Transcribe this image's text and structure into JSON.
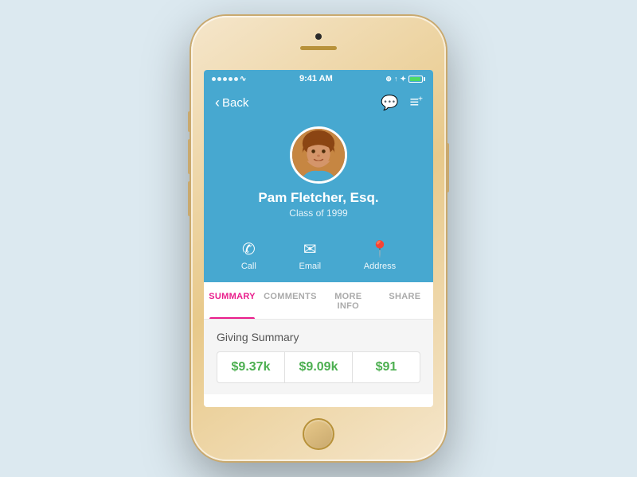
{
  "phone": {
    "status_bar": {
      "time": "9:41 AM",
      "signal_dots": 5,
      "wifi": "WiFi",
      "location_icon": "⊕",
      "arrow_icon": "↑",
      "bluetooth_icon": "❋",
      "battery_level": 80
    },
    "header": {
      "back_label": "Back",
      "comment_icon": "💬",
      "add_list_icon": "≡+"
    },
    "profile": {
      "name": "Pam Fletcher, Esq.",
      "subtitle": "Class of 1999"
    },
    "actions": [
      {
        "id": "call",
        "icon": "📞",
        "label": "Call"
      },
      {
        "id": "email",
        "icon": "✉",
        "label": "Email"
      },
      {
        "id": "address",
        "icon": "📍",
        "label": "Address"
      }
    ],
    "tabs": [
      {
        "id": "summary",
        "label": "SUMMARY",
        "active": true
      },
      {
        "id": "comments",
        "label": "COMMENTS",
        "active": false
      },
      {
        "id": "more_info",
        "label": "MORE INFO",
        "active": false
      },
      {
        "id": "share",
        "label": "SHARE",
        "active": false
      }
    ],
    "content": {
      "section_title": "Giving Summary",
      "giving_cells": [
        {
          "amount": "$9.37k"
        },
        {
          "amount": "$9.09k"
        },
        {
          "amount": "$91"
        }
      ]
    }
  }
}
